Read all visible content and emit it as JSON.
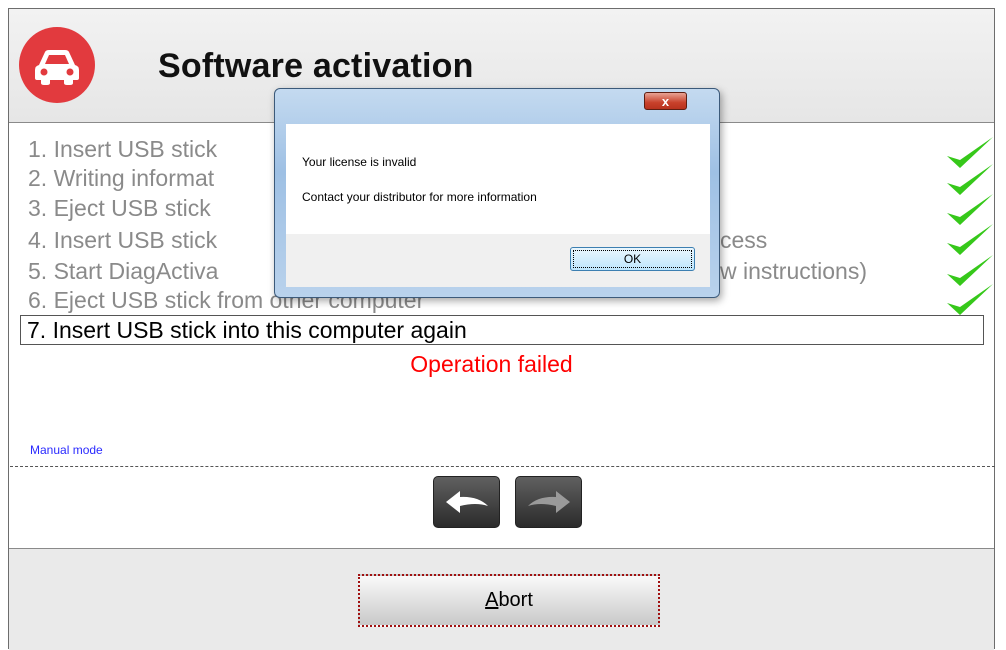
{
  "header": {
    "title": "Software activation",
    "logo_icon": "car-icon",
    "logo_color": "#e23a3e"
  },
  "steps": [
    {
      "label": "1. Insert USB stick",
      "done": true
    },
    {
      "label": "2. Writing informat",
      "done": true
    },
    {
      "label": "3. Eject USB stick",
      "done": true
    },
    {
      "label": "4. Insert USB stick",
      "suffix": "cess",
      "done": true
    },
    {
      "label": "5. Start DiagActiva",
      "suffix": "w instructions)",
      "done": true
    },
    {
      "label": "6. Eject USB stick from other computer",
      "done": true
    }
  ],
  "current_step": "7. Insert USB stick into this computer again",
  "error_message": "Operation failed",
  "manual_mode_label": "Manual mode",
  "nav": {
    "back_icon": "back-arrow-icon",
    "forward_icon": "forward-arrow-icon"
  },
  "abort": {
    "accel": "A",
    "rest": "bort"
  },
  "dialog": {
    "close_label": "x",
    "message_line1": "Your license is invalid",
    "message_line2": "Contact your distributor for more information",
    "ok_label": "OK"
  },
  "colors": {
    "error": "#ff0000",
    "link": "#2a2aff",
    "check": "#36c81a",
    "completed_text": "#8a8a8a"
  }
}
